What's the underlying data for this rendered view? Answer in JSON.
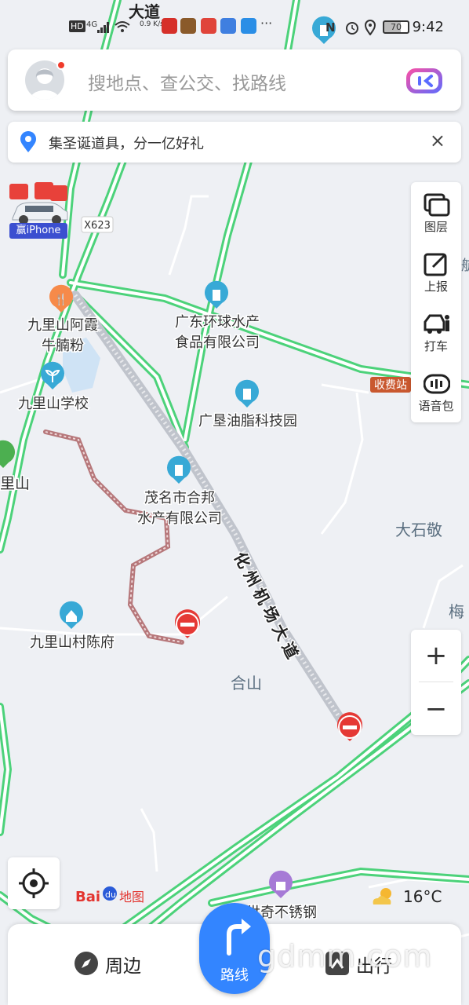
{
  "status_bar": {
    "hd": "HD",
    "network": "4G",
    "speed": "0.9 K/s",
    "nfc": "N",
    "battery": "70",
    "time": "9:42"
  },
  "search": {
    "placeholder": "搜地点、查公交、找路线"
  },
  "banner": {
    "text": "集圣诞道具，分一亿好礼",
    "close_icon": "×"
  },
  "promo": {
    "label": "赢iPhone"
  },
  "tools": [
    {
      "label": "图层",
      "icon": "layers-icon"
    },
    {
      "label": "上报",
      "icon": "report-icon"
    },
    {
      "label": "打车",
      "icon": "taxi-icon"
    },
    {
      "label": "语音包",
      "icon": "voice-pack-icon"
    }
  ],
  "zoom": {
    "in": "+",
    "out": "−"
  },
  "map": {
    "road_labels": {
      "airport_road": "化州机场大道",
      "top_road": "大道",
      "county_road": "X623",
      "toll": "收费站"
    },
    "pois": [
      {
        "name": "九里山阿霞牛腩粉",
        "line1": "九里山阿霞",
        "line2": "牛腩粉",
        "type": "food"
      },
      {
        "name": "广东环球水产食品有限公司",
        "line1": "广东环球水产",
        "line2": "食品有限公司",
        "type": "company"
      },
      {
        "name": "九里山学校",
        "line1": "九里山学校",
        "line2": "",
        "type": "school"
      },
      {
        "name": "广垦油脂科技园",
        "line1": "广垦油脂科技园",
        "line2": "",
        "type": "company"
      },
      {
        "name": "茂名市合邦水产有限公司",
        "line1": "茂名市合邦",
        "line2": "水产有限公司",
        "type": "company"
      },
      {
        "name": "九里山村陈府",
        "line1": "九里山村陈府",
        "line2": "",
        "type": "village"
      },
      {
        "name": "世奇不锈钢",
        "line1": "世奇不锈钢",
        "line2": "",
        "type": "shop"
      }
    ],
    "place_labels": {
      "dashijing": "大石敬",
      "heshan": "合山",
      "mei": "梅",
      "lishan": "里山",
      "right_edge": "航"
    }
  },
  "logo": {
    "text": "Bai 地图"
  },
  "weather": {
    "temp": "16°C",
    "icon": "partly-cloudy-icon"
  },
  "bottom_nav": {
    "nearby": "周边",
    "route": "路线",
    "trip": "出行"
  },
  "watermark": "gdmm.com",
  "colors": {
    "road_green": "#4cd27a",
    "closed_road": "#c0c4cc",
    "accent_blue": "#3385ff",
    "poi_teal": "#38a9d6",
    "food_orange": "#f68a4a",
    "shop_purple": "#a67ad6",
    "closed_red": "#e53935"
  }
}
